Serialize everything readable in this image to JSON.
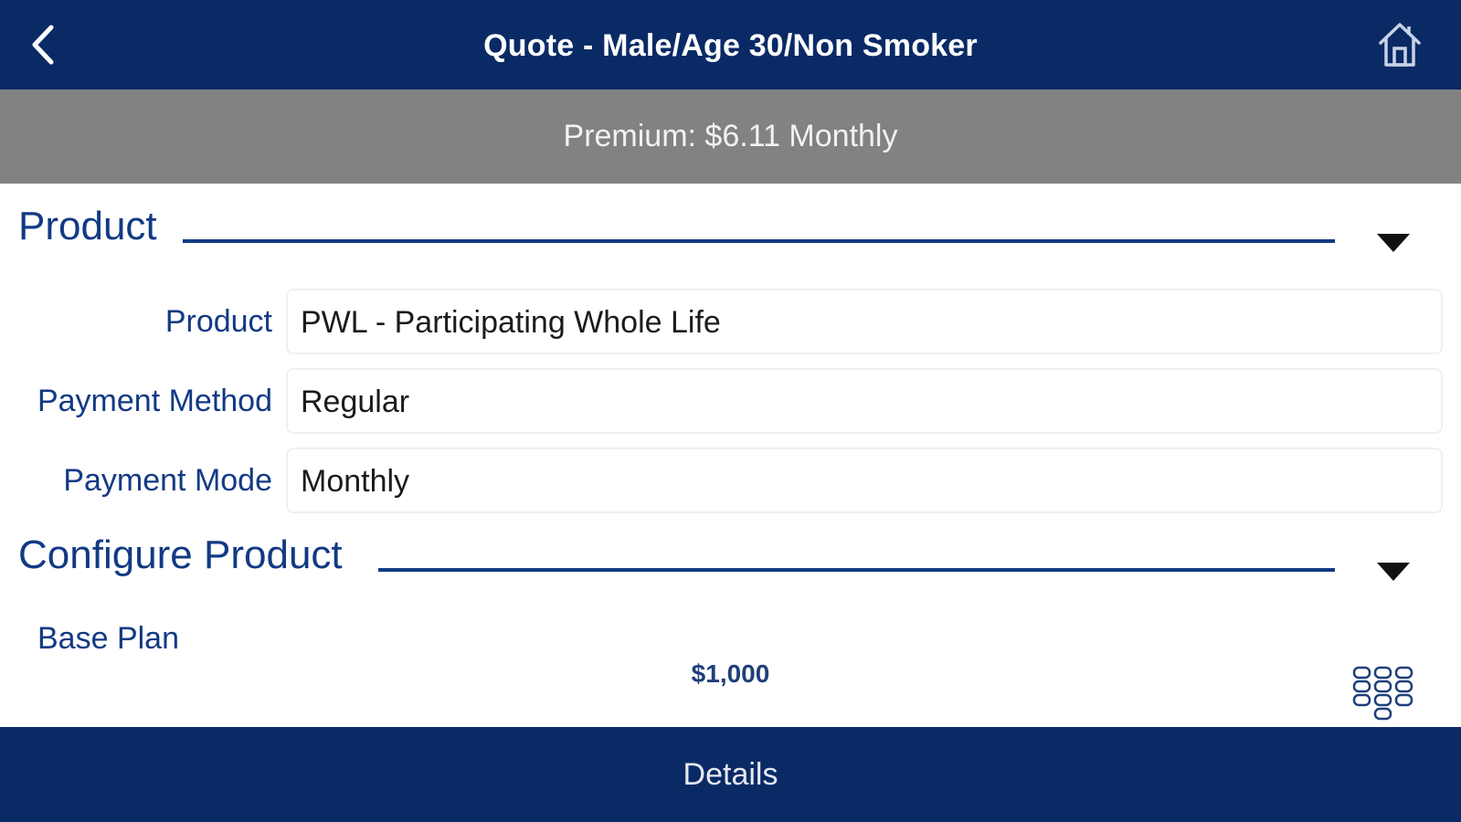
{
  "navbar": {
    "title": "Quote - Male/Age 30/Non Smoker",
    "back_icon": "chevron-left-icon",
    "home_icon": "home-icon"
  },
  "premium": {
    "text": "Premium: $6.11 Monthly"
  },
  "sections": {
    "product": {
      "title": "Product",
      "toggle_icon": "caret-down-icon"
    },
    "configure": {
      "title": "Configure Product",
      "toggle_icon": "caret-down-icon"
    }
  },
  "form": {
    "rows": [
      {
        "label": "Product",
        "value": "PWL - Participating Whole Life"
      },
      {
        "label": "Payment Method",
        "value": "Regular"
      },
      {
        "label": "Payment Mode",
        "value": "Monthly"
      }
    ]
  },
  "base_plan": {
    "label": "Base Plan",
    "amount": "$1,000",
    "keypad_icon": "keypad-icon"
  },
  "bottom_bar": {
    "label": "Details"
  },
  "colors": {
    "navbar_bg": "#0a2a66",
    "premium_bg": "#828282",
    "accent": "#123a84"
  }
}
